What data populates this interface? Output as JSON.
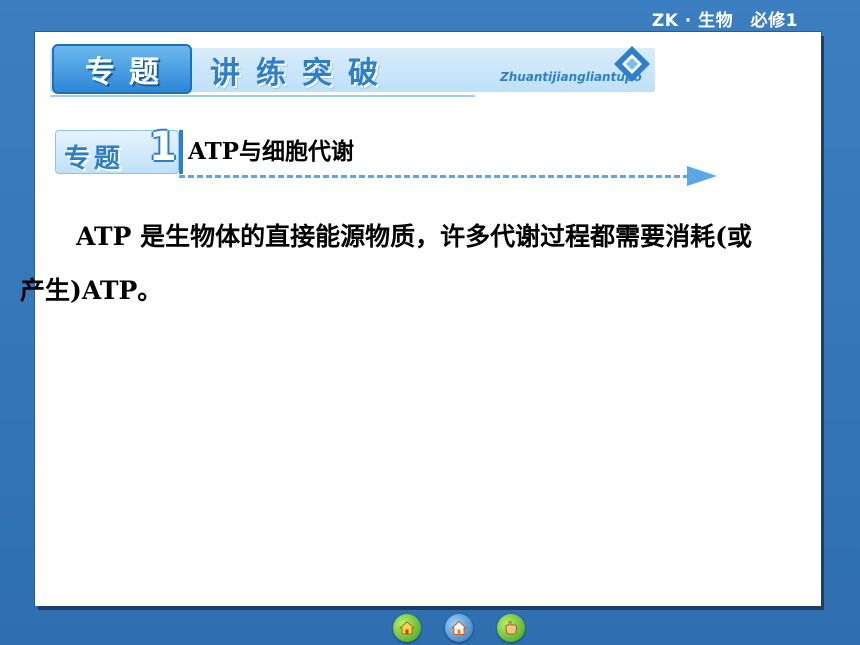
{
  "header": {
    "tag": "ZK · 生物　必修1"
  },
  "banner": {
    "label": "专题",
    "title": "讲练突破",
    "subtitle": "Zhuantijiangliantupo"
  },
  "section": {
    "badge_text": "专题",
    "number": "1",
    "title": "ATP与细胞代谢"
  },
  "body": {
    "paragraph": "ATP 是生物体的直接能源物质，许多代谢过程都需要消耗(或产生)ATP。"
  },
  "nav": {
    "buttons": [
      "previous-slide",
      "home",
      "next-slide"
    ],
    "icons": [
      "house-icon",
      "home-icon",
      "hand-icon"
    ]
  },
  "colors": {
    "background": "#3b7fc0",
    "accent_blue": "#2f7ec8",
    "banner_light": "#bfe0f8",
    "nav_green": "#3c9a1c"
  }
}
